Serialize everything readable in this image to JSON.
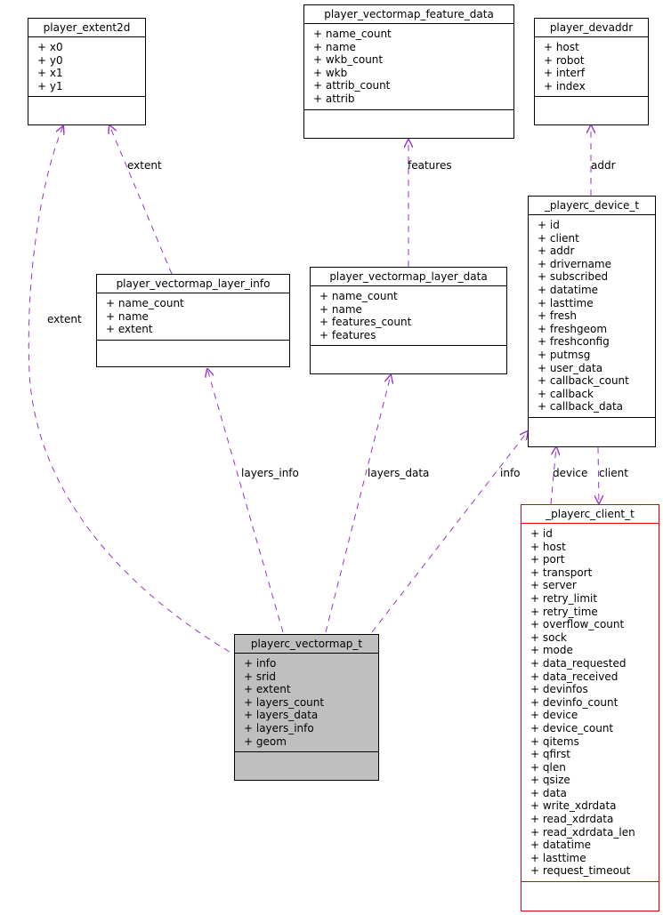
{
  "diagram": {
    "type": "collaboration-diagram",
    "nodes": {
      "extent2d": {
        "title": "player_extent2d",
        "attributes": [
          "+ x0",
          "+ y0",
          "+ x1",
          "+ y1"
        ]
      },
      "feature_data": {
        "title": "player_vectormap_feature_data",
        "attributes": [
          "+ name_count",
          "+ name",
          "+ wkb_count",
          "+ wkb",
          "+ attrib_count",
          "+ attrib"
        ]
      },
      "devaddr": {
        "title": "player_devaddr",
        "attributes": [
          "+ host",
          "+ robot",
          "+ interf",
          "+ index"
        ]
      },
      "layer_info": {
        "title": "player_vectormap_layer_info",
        "attributes": [
          "+ name_count",
          "+ name",
          "+ extent"
        ]
      },
      "layer_data": {
        "title": "player_vectormap_layer_data",
        "attributes": [
          "+ name_count",
          "+ name",
          "+ features_count",
          "+ features"
        ]
      },
      "device": {
        "title": "_playerc_device_t",
        "attributes": [
          "+ id",
          "+ client",
          "+ addr",
          "+ drivername",
          "+ subscribed",
          "+ datatime",
          "+ lasttime",
          "+ fresh",
          "+ freshgeom",
          "+ freshconfig",
          "+ putmsg",
          "+ user_data",
          "+ callback_count",
          "+ callback",
          "+ callback_data"
        ]
      },
      "client": {
        "title": "_playerc_client_t",
        "attributes": [
          "+ id",
          "+ host",
          "+ port",
          "+ transport",
          "+ server",
          "+ retry_limit",
          "+ retry_time",
          "+ overflow_count",
          "+ sock",
          "+ mode",
          "+ data_requested",
          "+ data_received",
          "+ devinfos",
          "+ devinfo_count",
          "+ device",
          "+ device_count",
          "+ qitems",
          "+ qfirst",
          "+ qlen",
          "+ qsize",
          "+ data",
          "+ write_xdrdata",
          "+ read_xdrdata",
          "+ read_xdrdata_len",
          "+ datatime",
          "+ lasttime",
          "+ request_timeout"
        ]
      },
      "vectormap": {
        "title": "playerc_vectormap_t",
        "attributes": [
          "+ info",
          "+ srid",
          "+ extent",
          "+ layers_count",
          "+ layers_data",
          "+ layers_info",
          "+ geom"
        ]
      }
    },
    "edges": [
      {
        "from": "vectormap",
        "to": "extent2d",
        "label": "extent"
      },
      {
        "from": "layer_info",
        "to": "extent2d",
        "label": "extent"
      },
      {
        "from": "layer_data",
        "to": "feature_data",
        "label": "features"
      },
      {
        "from": "device",
        "to": "devaddr",
        "label": "addr"
      },
      {
        "from": "vectormap",
        "to": "layer_info",
        "label": "layers_info"
      },
      {
        "from": "vectormap",
        "to": "layer_data",
        "label": "layers_data"
      },
      {
        "from": "vectormap",
        "to": "device",
        "label": "info"
      },
      {
        "from": "client",
        "to": "device",
        "label": "device"
      },
      {
        "from": "device",
        "to": "client",
        "label": "client"
      }
    ],
    "colors": {
      "edge": "#9a32cd",
      "focus_fill": "#bfbfbf",
      "highlight_border": "#e00000",
      "border": "#000000"
    }
  }
}
